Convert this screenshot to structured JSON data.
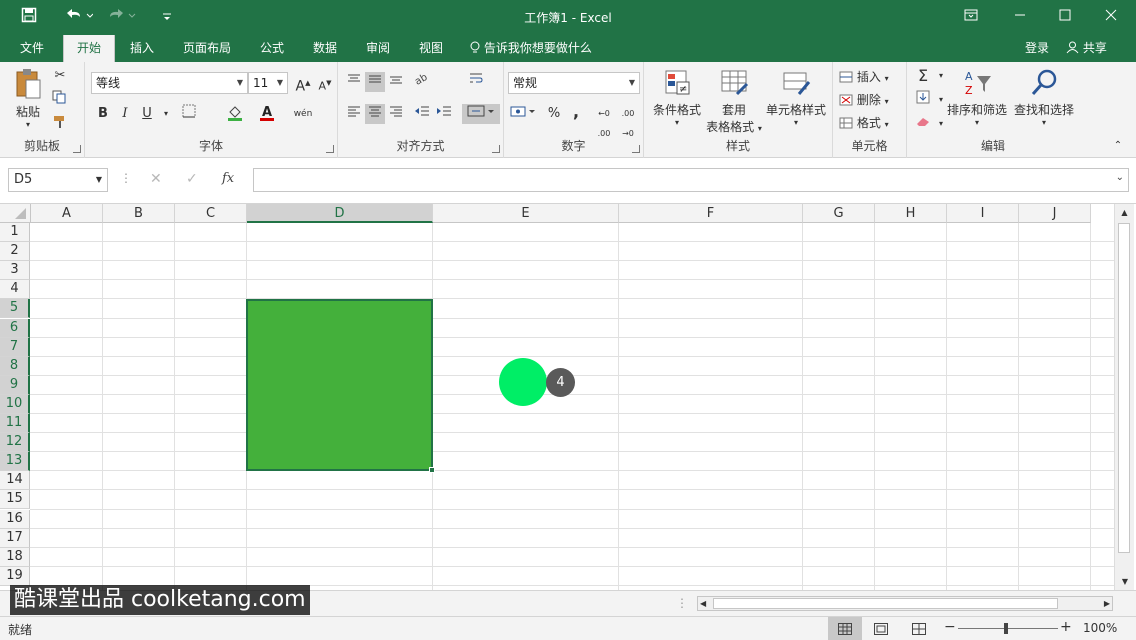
{
  "titlebar": {
    "title": "工作簿1 - Excel",
    "save_icon": "save-icon",
    "undo_icon": "undo-icon",
    "redo_icon": "redo-icon"
  },
  "tabs": {
    "items": [
      "文件",
      "开始",
      "插入",
      "页面布局",
      "公式",
      "数据",
      "审阅",
      "视图"
    ],
    "active": "开始",
    "tell_me": "告诉我你想要做什么",
    "login": "登录",
    "share": "共享"
  },
  "ribbon": {
    "clipboard": {
      "label": "剪贴板",
      "paste": "粘贴"
    },
    "font": {
      "label": "字体",
      "font_name": "等线",
      "font_size": "11",
      "bold": "B",
      "italic": "I",
      "underline": "U",
      "grow": "A",
      "shrink": "A",
      "phonetic": "wén"
    },
    "alignment": {
      "label": "对齐方式"
    },
    "number": {
      "label": "数字",
      "format": "常规",
      "percent": "%",
      "comma": ","
    },
    "styles": {
      "label": "样式",
      "conditional": "条件格式",
      "table_format_1": "套用",
      "table_format_2": "表格格式",
      "cell_styles": "单元格样式"
    },
    "cells": {
      "label": "单元格",
      "insert": "插入",
      "delete": "删除",
      "format": "格式"
    },
    "editing": {
      "label": "编辑",
      "sort_filter": "排序和筛选",
      "find_select": "查找和选择"
    }
  },
  "formula_bar": {
    "name_box": "D5",
    "fx": "fx",
    "value": ""
  },
  "grid": {
    "columns": [
      "A",
      "B",
      "C",
      "D",
      "E",
      "F",
      "G",
      "H",
      "I",
      "J"
    ],
    "rows": [
      "1",
      "2",
      "3",
      "4",
      "5",
      "6",
      "7",
      "8",
      "9",
      "10",
      "11",
      "12",
      "13",
      "14",
      "15",
      "16",
      "17",
      "18",
      "19"
    ],
    "selected_column": "D",
    "selected_range": "D5:D13",
    "selection_color": "#44b03b"
  },
  "overlay": {
    "click_marker_color": "#00ee66",
    "step_badge": "4",
    "watermark": "酷课堂出品 coolketang.com"
  },
  "statusbar": {
    "ready": "就绪",
    "zoom": "100%"
  }
}
